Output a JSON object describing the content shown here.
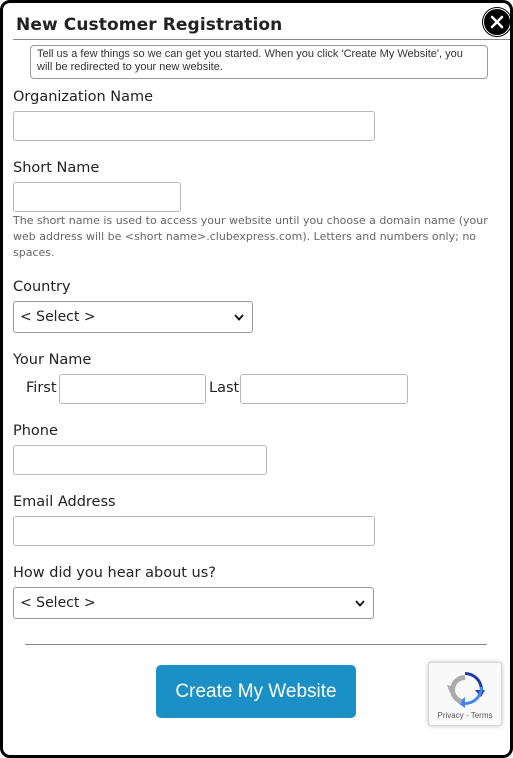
{
  "dialog": {
    "title": "New Customer Registration",
    "intro": "Tell us a few things so we can get you started. When you click 'Create My Website', you will be redirected to your new website."
  },
  "form": {
    "organization_name": {
      "label": "Organization Name",
      "value": ""
    },
    "short_name": {
      "label": "Short Name",
      "value": "",
      "help": "The short name is used to access your website until you choose a domain name (your web address will be <short name>.clubexpress.com). Letters and numbers only; no spaces."
    },
    "country": {
      "label": "Country",
      "selected": "< Select >"
    },
    "your_name": {
      "label": "Your Name",
      "first_label": "First",
      "last_label": "Last",
      "first_value": "",
      "last_value": ""
    },
    "phone": {
      "label": "Phone",
      "value": ""
    },
    "email": {
      "label": "Email Address",
      "value": ""
    },
    "referral": {
      "label": "How did you hear about us?",
      "selected": "< Select >"
    }
  },
  "submit_label": "Create My Website",
  "recaptcha": {
    "privacy": "Privacy",
    "separator": "-",
    "terms": "Terms"
  },
  "colors": {
    "accent": "#1a90c6"
  },
  "icons": {
    "close": "close-icon",
    "dropdown": "chevron-down-icon",
    "recaptcha": "recaptcha-logo-icon"
  }
}
